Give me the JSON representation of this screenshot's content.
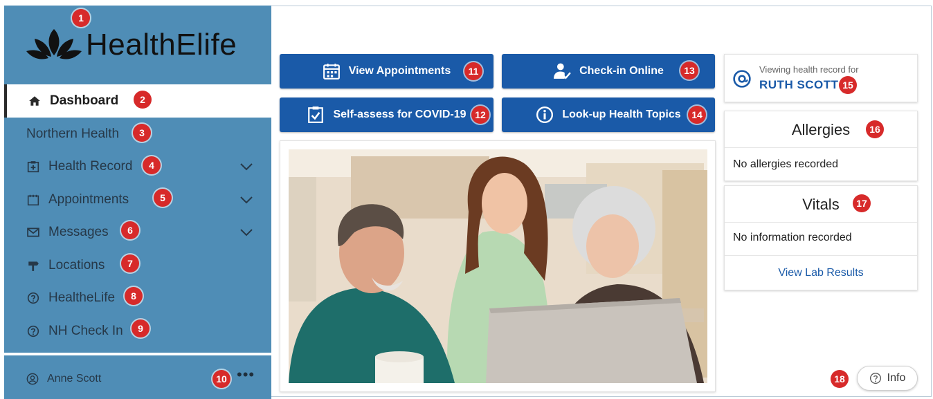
{
  "app": {
    "logo_text": "HealthElife"
  },
  "sidebar": {
    "items": [
      {
        "label": "Dashboard",
        "icon": "home-icon",
        "active": true
      },
      {
        "label": "Northern Health",
        "icon": ""
      },
      {
        "label": "Health Record",
        "icon": "medical-record-icon",
        "expandable": true
      },
      {
        "label": "Appointments",
        "icon": "calendar-icon",
        "expandable": true
      },
      {
        "label": "Messages",
        "icon": "envelope-icon",
        "expandable": true
      },
      {
        "label": "Locations",
        "icon": "signpost-icon"
      },
      {
        "label": "HealtheLife",
        "icon": "help-circle-icon"
      },
      {
        "label": "NH Check In",
        "icon": "help-circle-icon"
      }
    ],
    "user": {
      "name": "Anne Scott",
      "more": "•••"
    }
  },
  "actions": {
    "view_appointments": "View Appointments",
    "check_in": "Check-in Online",
    "self_assess": "Self-assess for COVID-19",
    "lookup": "Look-up Health Topics"
  },
  "viewing": {
    "label": "Viewing health record for",
    "name": "RUTH SCOTT"
  },
  "allergies": {
    "title": "Allergies",
    "text": "No allergies recorded"
  },
  "vitals": {
    "title": "Vitals",
    "text": "No information recorded",
    "link": "View Lab Results"
  },
  "info_button": "Info",
  "badges": [
    "1",
    "2",
    "3",
    "4",
    "5",
    "6",
    "7",
    "8",
    "9",
    "10",
    "11",
    "12",
    "13",
    "14",
    "15",
    "16",
    "17",
    "18"
  ],
  "colors": {
    "sidebar": "#4f8db6",
    "primary": "#1a5aa8",
    "badge": "#d72a2a"
  }
}
